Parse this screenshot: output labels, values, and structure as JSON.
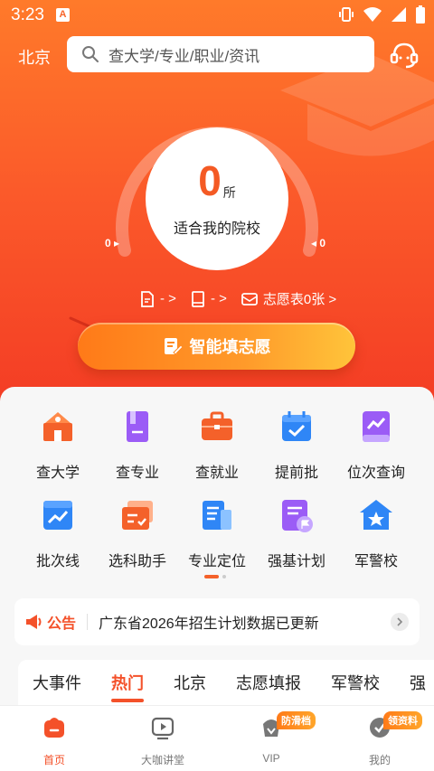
{
  "status": {
    "time": "3:23",
    "notif_letter": "A"
  },
  "header": {
    "city": "北京",
    "search_placeholder": "查大学/专业/职业/资讯"
  },
  "gauge": {
    "count": "0",
    "unit": "所",
    "label": "适合我的院校",
    "left_value": "0",
    "right_value": "0"
  },
  "stats": [
    {
      "icon": "document-icon",
      "label": "- >"
    },
    {
      "icon": "book-icon",
      "label": "- >"
    },
    {
      "icon": "mail-icon",
      "label": "志愿表0张 >"
    }
  ],
  "cta": {
    "label": "智能填志愿"
  },
  "grid": [
    {
      "label": "查大学",
      "icon": "school-icon",
      "color": "#f4612a"
    },
    {
      "label": "查专业",
      "icon": "book-icon",
      "color": "#9b5cf6"
    },
    {
      "label": "查就业",
      "icon": "briefcase-icon",
      "color": "#f4612a"
    },
    {
      "label": "提前批",
      "icon": "calendar-check-icon",
      "color": "#2f86f6"
    },
    {
      "label": "位次查询",
      "icon": "chart-book-icon",
      "color": "#9b5cf6"
    },
    {
      "label": "批次线",
      "icon": "trend-icon",
      "color": "#2f86f6"
    },
    {
      "label": "选科助手",
      "icon": "cards-icon",
      "color": "#f4612a"
    },
    {
      "label": "专业定位",
      "icon": "locate-doc-icon",
      "color": "#2f86f6"
    },
    {
      "label": "强基计划",
      "icon": "plan-flag-icon",
      "color": "#9b5cf6"
    },
    {
      "label": "军警校",
      "icon": "star-house-icon",
      "color": "#2f86f6"
    }
  ],
  "notice": {
    "tag": "公告",
    "text": "广东省2026年招生计划数据已更新"
  },
  "feed_tabs": [
    "大事件",
    "热门",
    "北京",
    "志愿填报",
    "军警校",
    "强"
  ],
  "bottom_nav": [
    {
      "label": "首页",
      "icon": "home-icon"
    },
    {
      "label": "大咖讲堂",
      "icon": "play-icon"
    },
    {
      "label": "VIP",
      "icon": "vip-icon",
      "badge": "防滑档"
    },
    {
      "label": "我的",
      "icon": "profile-icon",
      "badge": "领资料"
    }
  ],
  "colors": {
    "accent": "#f4512a",
    "hero_top": "#ff7a2a",
    "hero_bottom": "#f33a24"
  }
}
